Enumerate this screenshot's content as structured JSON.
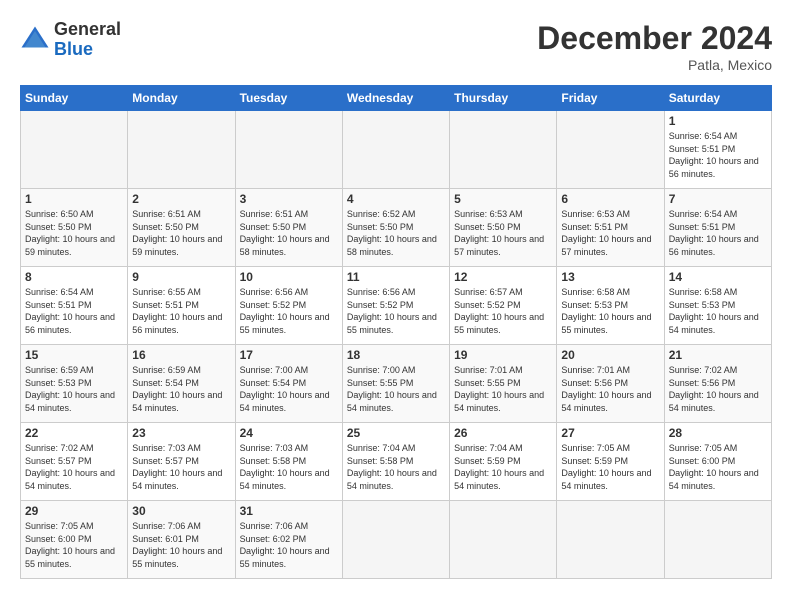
{
  "header": {
    "logo_line1": "General",
    "logo_line2": "Blue",
    "title": "December 2024",
    "location": "Patla, Mexico"
  },
  "calendar": {
    "days_of_week": [
      "Sunday",
      "Monday",
      "Tuesday",
      "Wednesday",
      "Thursday",
      "Friday",
      "Saturday"
    ],
    "weeks": [
      [
        {
          "day": "",
          "empty": true
        },
        {
          "day": "",
          "empty": true
        },
        {
          "day": "",
          "empty": true
        },
        {
          "day": "",
          "empty": true
        },
        {
          "day": "",
          "empty": true
        },
        {
          "day": "",
          "empty": true
        },
        {
          "day": "1",
          "sunrise": "Sunrise: 6:54 AM",
          "sunset": "Sunset: 5:51 PM",
          "daylight": "Daylight: 10 hours and 56 minutes."
        }
      ],
      [
        {
          "day": "1",
          "sunrise": "Sunrise: 6:50 AM",
          "sunset": "Sunset: 5:50 PM",
          "daylight": "Daylight: 10 hours and 59 minutes."
        },
        {
          "day": "2",
          "sunrise": "Sunrise: 6:51 AM",
          "sunset": "Sunset: 5:50 PM",
          "daylight": "Daylight: 10 hours and 59 minutes."
        },
        {
          "day": "3",
          "sunrise": "Sunrise: 6:51 AM",
          "sunset": "Sunset: 5:50 PM",
          "daylight": "Daylight: 10 hours and 58 minutes."
        },
        {
          "day": "4",
          "sunrise": "Sunrise: 6:52 AM",
          "sunset": "Sunset: 5:50 PM",
          "daylight": "Daylight: 10 hours and 58 minutes."
        },
        {
          "day": "5",
          "sunrise": "Sunrise: 6:53 AM",
          "sunset": "Sunset: 5:50 PM",
          "daylight": "Daylight: 10 hours and 57 minutes."
        },
        {
          "day": "6",
          "sunrise": "Sunrise: 6:53 AM",
          "sunset": "Sunset: 5:51 PM",
          "daylight": "Daylight: 10 hours and 57 minutes."
        },
        {
          "day": "7",
          "sunrise": "Sunrise: 6:54 AM",
          "sunset": "Sunset: 5:51 PM",
          "daylight": "Daylight: 10 hours and 56 minutes."
        }
      ],
      [
        {
          "day": "8",
          "sunrise": "Sunrise: 6:54 AM",
          "sunset": "Sunset: 5:51 PM",
          "daylight": "Daylight: 10 hours and 56 minutes."
        },
        {
          "day": "9",
          "sunrise": "Sunrise: 6:55 AM",
          "sunset": "Sunset: 5:51 PM",
          "daylight": "Daylight: 10 hours and 56 minutes."
        },
        {
          "day": "10",
          "sunrise": "Sunrise: 6:56 AM",
          "sunset": "Sunset: 5:52 PM",
          "daylight": "Daylight: 10 hours and 55 minutes."
        },
        {
          "day": "11",
          "sunrise": "Sunrise: 6:56 AM",
          "sunset": "Sunset: 5:52 PM",
          "daylight": "Daylight: 10 hours and 55 minutes."
        },
        {
          "day": "12",
          "sunrise": "Sunrise: 6:57 AM",
          "sunset": "Sunset: 5:52 PM",
          "daylight": "Daylight: 10 hours and 55 minutes."
        },
        {
          "day": "13",
          "sunrise": "Sunrise: 6:58 AM",
          "sunset": "Sunset: 5:53 PM",
          "daylight": "Daylight: 10 hours and 55 minutes."
        },
        {
          "day": "14",
          "sunrise": "Sunrise: 6:58 AM",
          "sunset": "Sunset: 5:53 PM",
          "daylight": "Daylight: 10 hours and 54 minutes."
        }
      ],
      [
        {
          "day": "15",
          "sunrise": "Sunrise: 6:59 AM",
          "sunset": "Sunset: 5:53 PM",
          "daylight": "Daylight: 10 hours and 54 minutes."
        },
        {
          "day": "16",
          "sunrise": "Sunrise: 6:59 AM",
          "sunset": "Sunset: 5:54 PM",
          "daylight": "Daylight: 10 hours and 54 minutes."
        },
        {
          "day": "17",
          "sunrise": "Sunrise: 7:00 AM",
          "sunset": "Sunset: 5:54 PM",
          "daylight": "Daylight: 10 hours and 54 minutes."
        },
        {
          "day": "18",
          "sunrise": "Sunrise: 7:00 AM",
          "sunset": "Sunset: 5:55 PM",
          "daylight": "Daylight: 10 hours and 54 minutes."
        },
        {
          "day": "19",
          "sunrise": "Sunrise: 7:01 AM",
          "sunset": "Sunset: 5:55 PM",
          "daylight": "Daylight: 10 hours and 54 minutes."
        },
        {
          "day": "20",
          "sunrise": "Sunrise: 7:01 AM",
          "sunset": "Sunset: 5:56 PM",
          "daylight": "Daylight: 10 hours and 54 minutes."
        },
        {
          "day": "21",
          "sunrise": "Sunrise: 7:02 AM",
          "sunset": "Sunset: 5:56 PM",
          "daylight": "Daylight: 10 hours and 54 minutes."
        }
      ],
      [
        {
          "day": "22",
          "sunrise": "Sunrise: 7:02 AM",
          "sunset": "Sunset: 5:57 PM",
          "daylight": "Daylight: 10 hours and 54 minutes."
        },
        {
          "day": "23",
          "sunrise": "Sunrise: 7:03 AM",
          "sunset": "Sunset: 5:57 PM",
          "daylight": "Daylight: 10 hours and 54 minutes."
        },
        {
          "day": "24",
          "sunrise": "Sunrise: 7:03 AM",
          "sunset": "Sunset: 5:58 PM",
          "daylight": "Daylight: 10 hours and 54 minutes."
        },
        {
          "day": "25",
          "sunrise": "Sunrise: 7:04 AM",
          "sunset": "Sunset: 5:58 PM",
          "daylight": "Daylight: 10 hours and 54 minutes."
        },
        {
          "day": "26",
          "sunrise": "Sunrise: 7:04 AM",
          "sunset": "Sunset: 5:59 PM",
          "daylight": "Daylight: 10 hours and 54 minutes."
        },
        {
          "day": "27",
          "sunrise": "Sunrise: 7:05 AM",
          "sunset": "Sunset: 5:59 PM",
          "daylight": "Daylight: 10 hours and 54 minutes."
        },
        {
          "day": "28",
          "sunrise": "Sunrise: 7:05 AM",
          "sunset": "Sunset: 6:00 PM",
          "daylight": "Daylight: 10 hours and 54 minutes."
        }
      ],
      [
        {
          "day": "29",
          "sunrise": "Sunrise: 7:05 AM",
          "sunset": "Sunset: 6:00 PM",
          "daylight": "Daylight: 10 hours and 55 minutes."
        },
        {
          "day": "30",
          "sunrise": "Sunrise: 7:06 AM",
          "sunset": "Sunset: 6:01 PM",
          "daylight": "Daylight: 10 hours and 55 minutes."
        },
        {
          "day": "31",
          "sunrise": "Sunrise: 7:06 AM",
          "sunset": "Sunset: 6:02 PM",
          "daylight": "Daylight: 10 hours and 55 minutes."
        },
        {
          "day": "",
          "empty": true
        },
        {
          "day": "",
          "empty": true
        },
        {
          "day": "",
          "empty": true
        },
        {
          "day": "",
          "empty": true
        }
      ]
    ]
  }
}
